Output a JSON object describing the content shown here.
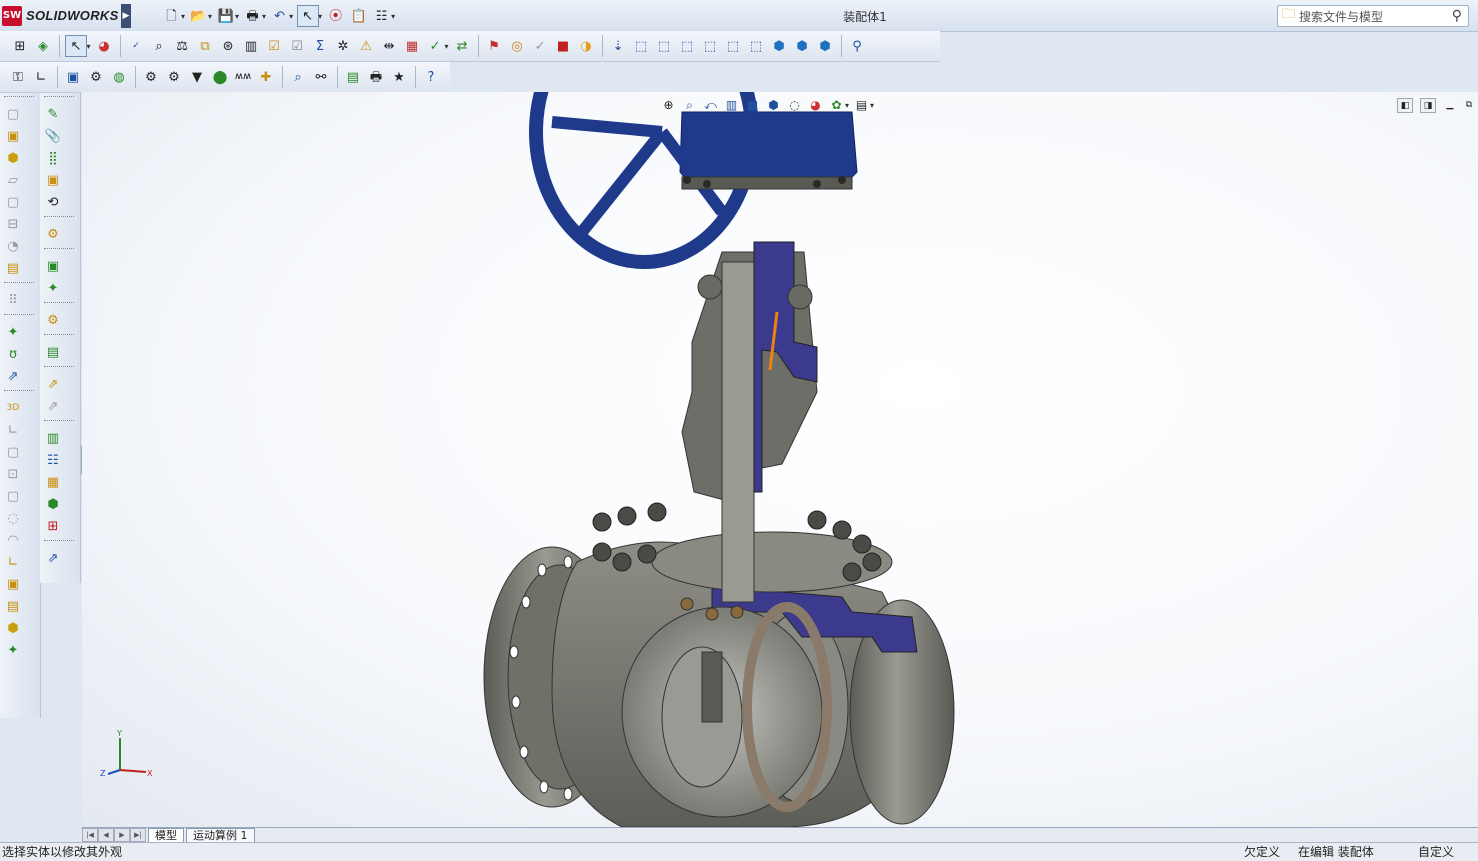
{
  "app": {
    "name": "SOLIDWORKS",
    "logo_badge": "SW",
    "document_title": "装配体1"
  },
  "search": {
    "placeholder": "搜索文件与模型"
  },
  "tabs": [
    {
      "label": "模型"
    },
    {
      "label": "运动算例 1"
    }
  ],
  "status": {
    "hint": "选择实体以修改其外观",
    "definition": "欠定义",
    "mode": "在编辑 装配体",
    "units": "自定义"
  },
  "triad": {
    "x": "X",
    "y": "Y",
    "z": "Z"
  },
  "colors": {
    "accent": "#1f3a8a",
    "valve_body": "#7f7f78",
    "section": "#3c3a8c",
    "background": "#ffffff"
  }
}
